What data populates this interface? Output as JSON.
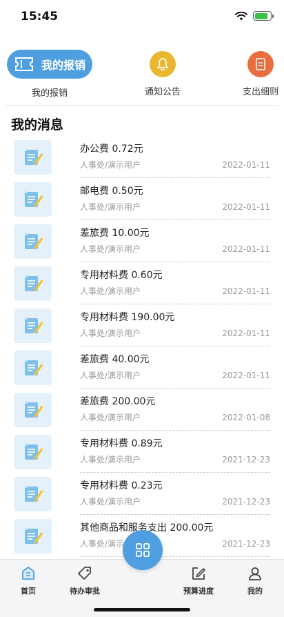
{
  "status_bar": {
    "time": "15:45"
  },
  "quick_nav": {
    "items": [
      {
        "label": "我的报销",
        "pill_text": "我的报销",
        "icon": "ticket-icon",
        "color": "#4f9fe0"
      },
      {
        "label": "通知公告",
        "icon": "bell-icon",
        "color": "#e9b730"
      },
      {
        "label": "支出细则",
        "icon": "document-icon",
        "color": "#e96e3e"
      }
    ]
  },
  "messages_section": {
    "title": "我的消息",
    "items": [
      {
        "title": "办公费 0.72元",
        "subtitle": "人事处/演示用户",
        "date": "2022-01-11"
      },
      {
        "title": "邮电费 0.50元",
        "subtitle": "人事处/演示用户",
        "date": "2022-01-11"
      },
      {
        "title": "差旅费 10.00元",
        "subtitle": "人事处/演示用户",
        "date": "2022-01-11"
      },
      {
        "title": "专用材料费 0.60元",
        "subtitle": "人事处/演示用户",
        "date": "2022-01-11"
      },
      {
        "title": "专用材料费 190.00元",
        "subtitle": "人事处/演示用户",
        "date": "2022-01-11"
      },
      {
        "title": "差旅费 40.00元",
        "subtitle": "人事处/演示用户",
        "date": "2022-01-11"
      },
      {
        "title": "差旅费 200.00元",
        "subtitle": "人事处/演示用户",
        "date": "2022-01-08"
      },
      {
        "title": "专用材料费 0.89元",
        "subtitle": "人事处/演示用户",
        "date": "2021-12-23"
      },
      {
        "title": "专用材料费 0.23元",
        "subtitle": "人事处/演示用户",
        "date": "2021-12-23"
      },
      {
        "title": "其他商品和服务支出 200.00元",
        "subtitle": "人事处/演示用户",
        "date": "2021-12-23"
      }
    ]
  },
  "tabbar": {
    "items": [
      {
        "label": "首页",
        "icon": "home-icon",
        "active": true
      },
      {
        "label": "待办审批",
        "icon": "tag-icon"
      },
      {
        "label": "",
        "icon": "grid-icon"
      },
      {
        "label": "预算进度",
        "icon": "edit-icon"
      },
      {
        "label": "我的",
        "icon": "user-icon"
      }
    ]
  },
  "colors": {
    "accent": "#4f9fe0",
    "bell": "#e9b730",
    "doc": "#e96e3e"
  }
}
